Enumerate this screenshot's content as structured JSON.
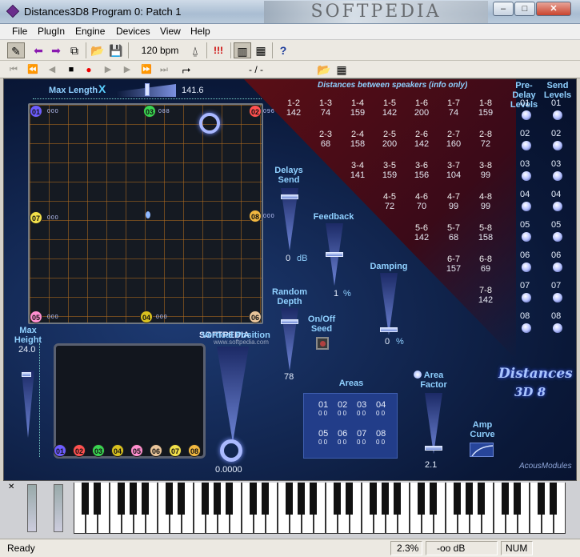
{
  "window": {
    "title": "Distances3D8 Program 0: Patch   1",
    "watermark": "SOFTPEDIA",
    "btn_min": "–",
    "btn_max": "□",
    "btn_close": "✕"
  },
  "menu": [
    "File",
    "PlugIn",
    "Engine",
    "Devices",
    "View",
    "Help"
  ],
  "toolbar": {
    "bpm": "120 bpm",
    "alert": "!!!",
    "help": "?",
    "position": "- / -"
  },
  "panel": {
    "max_length_label": "Max Length",
    "max_length_axis": "X",
    "max_length_value": "141.6",
    "distances_header": "Distances between speakers (info only)",
    "predelay_header": "Pre-Delay Levels",
    "send_header": "Send Levels",
    "max_height_label": "Max Height",
    "max_height_value": "24.0",
    "vertical_position_label": "Vertical Position",
    "vertical_position_value": "0.0000",
    "delays_send_label": "Delays Send",
    "delays_send_value": "0",
    "delays_send_unit": "dB",
    "feedback_label": "Feedback",
    "feedback_value": "1",
    "feedback_unit": "%",
    "damping_label": "Damping",
    "damping_value": "0",
    "damping_unit": "%",
    "random_depth_label": "Random Depth",
    "random_depth_value": "78",
    "onoff_seed_label": "On/Off Seed",
    "areas_label": "Areas",
    "area_factor_label": "Area Factor",
    "area_factor_value": "2.1",
    "amp_curve_label": "Amp Curve",
    "logo_line1": "Distances",
    "logo_line2": "3D 8",
    "brand": "AcousModules",
    "watermark2": "SOFTPEDIA",
    "watermark_url": "www.softpedia.com"
  },
  "speakers": [
    {
      "id": "01",
      "color": "#6c5cff",
      "tag": "000"
    },
    {
      "id": "02",
      "color": "#ff5050",
      "tag": "096"
    },
    {
      "id": "03",
      "color": "#39d451",
      "tag": "088"
    },
    {
      "id": "04",
      "color": "#d9c11f",
      "tag": "000"
    },
    {
      "id": "05",
      "color": "#ff8fd0",
      "tag": "000"
    },
    {
      "id": "06",
      "color": "#e8c49a",
      "tag": ""
    },
    {
      "id": "07",
      "color": "#f2e04a",
      "tag": "000"
    },
    {
      "id": "08",
      "color": "#f2b840",
      "tag": "000"
    }
  ],
  "distances": [
    {
      "pair": "1-2",
      "value": "142"
    },
    {
      "pair": "1-3",
      "value": "74"
    },
    {
      "pair": "1-4",
      "value": "159"
    },
    {
      "pair": "1-5",
      "value": "142"
    },
    {
      "pair": "1-6",
      "value": "200"
    },
    {
      "pair": "1-7",
      "value": "74"
    },
    {
      "pair": "1-8",
      "value": "159"
    },
    {
      "pair": "2-3",
      "value": "68"
    },
    {
      "pair": "2-4",
      "value": "158"
    },
    {
      "pair": "2-5",
      "value": "200"
    },
    {
      "pair": "2-6",
      "value": "142"
    },
    {
      "pair": "2-7",
      "value": "160"
    },
    {
      "pair": "2-8",
      "value": "72"
    },
    {
      "pair": "3-4",
      "value": "141"
    },
    {
      "pair": "3-5",
      "value": "159"
    },
    {
      "pair": "3-6",
      "value": "156"
    },
    {
      "pair": "3-7",
      "value": "104"
    },
    {
      "pair": "3-8",
      "value": "99"
    },
    {
      "pair": "4-5",
      "value": "72"
    },
    {
      "pair": "4-6",
      "value": "70"
    },
    {
      "pair": "4-7",
      "value": "99"
    },
    {
      "pair": "4-8",
      "value": "99"
    },
    {
      "pair": "5-6",
      "value": "142"
    },
    {
      "pair": "5-7",
      "value": "68"
    },
    {
      "pair": "5-8",
      "value": "158"
    },
    {
      "pair": "6-7",
      "value": "157"
    },
    {
      "pair": "6-8",
      "value": "69"
    },
    {
      "pair": "7-8",
      "value": "142"
    }
  ],
  "levels": [
    "01",
    "02",
    "03",
    "04",
    "05",
    "06",
    "07",
    "08"
  ],
  "areas": {
    "top": [
      "01",
      "02",
      "03",
      "04"
    ],
    "bottom": [
      "05",
      "06",
      "07",
      "08"
    ],
    "sub": "0 0"
  },
  "status": {
    "ready": "Ready",
    "cpu": "2.3%",
    "db": "-oo dB",
    "num": "NUM"
  }
}
